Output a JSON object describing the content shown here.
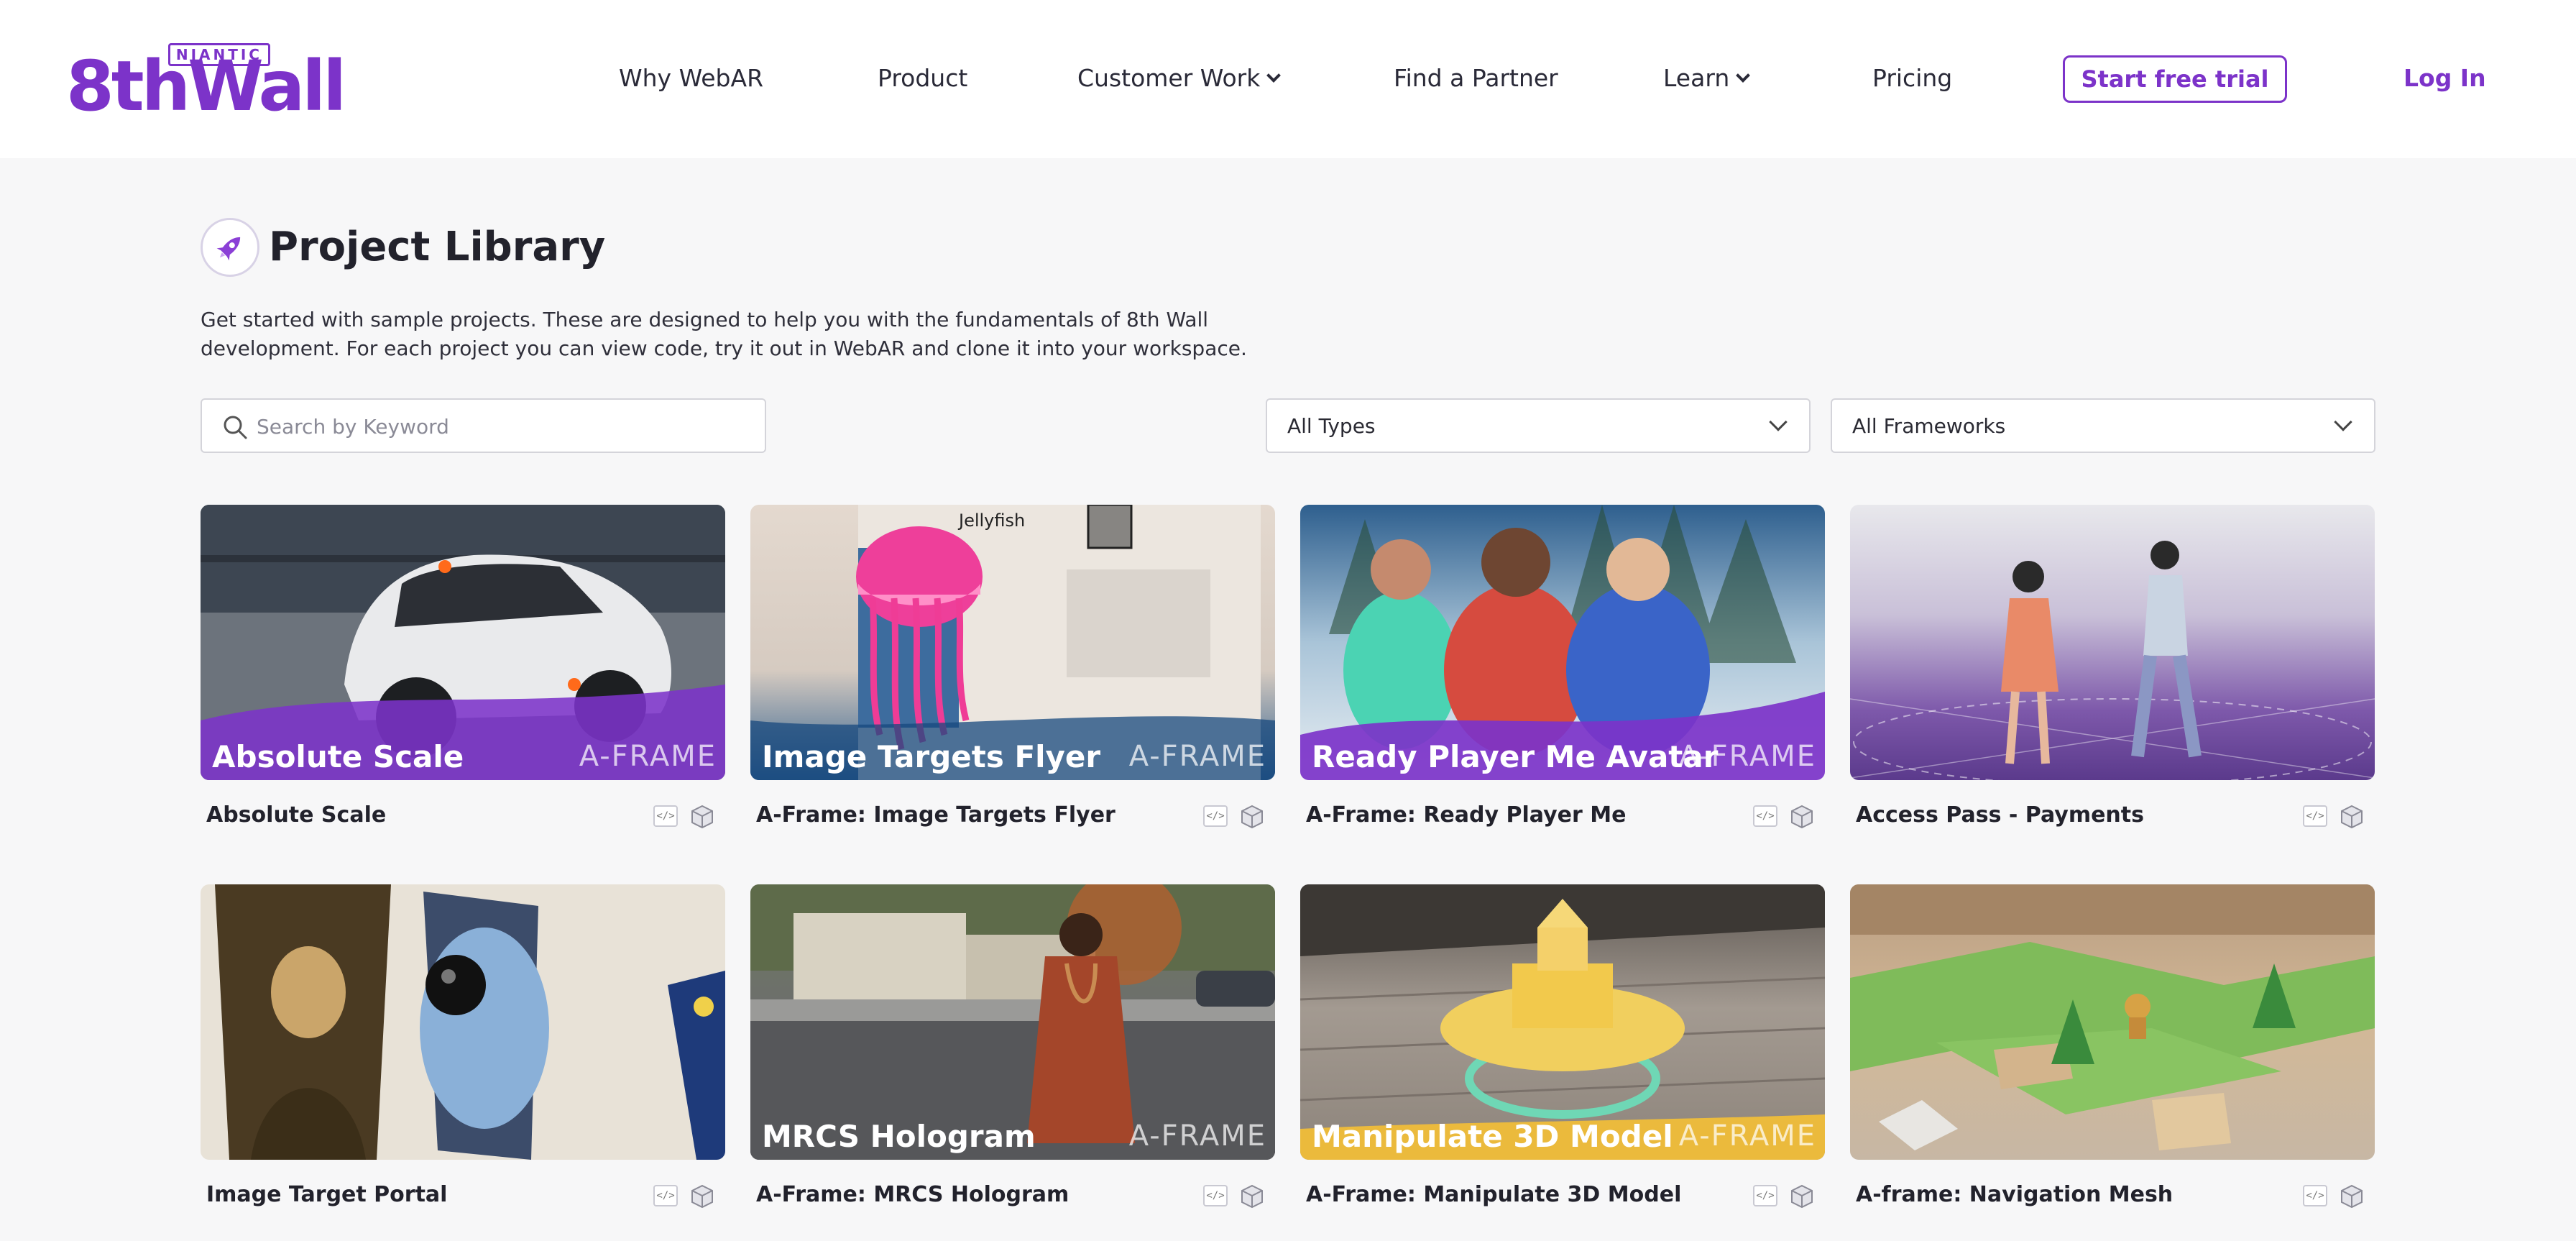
{
  "header": {
    "logo_badge": "NIANTIC",
    "logo_word": "8thWall",
    "nav": [
      {
        "label": "Why WebAR",
        "dropdown": false
      },
      {
        "label": "Product",
        "dropdown": false
      },
      {
        "label": "Customer Work",
        "dropdown": true
      },
      {
        "label": "Find a Partner",
        "dropdown": false
      },
      {
        "label": "Learn",
        "dropdown": true
      },
      {
        "label": "Pricing",
        "dropdown": false
      }
    ],
    "trial_button": "Start free trial",
    "login": "Log In"
  },
  "page": {
    "title": "Project Library",
    "intro": "Get started with sample projects. These are designed to help you with the fundamentals of 8th Wall development. For each project you can view code, try it out in WebAR and clone it into your workspace."
  },
  "filters": {
    "search_placeholder": "Search by Keyword",
    "search_value": "",
    "type_select": "All Types",
    "framework_select": "All Frameworks"
  },
  "projects": [
    {
      "title": "Absolute Scale",
      "thumb_label": "Absolute Scale",
      "thumb_tag": "A-FRAME"
    },
    {
      "title": "A-Frame: Image Targets Flyer",
      "thumb_label": "Image Targets Flyer",
      "thumb_tag": "A-FRAME",
      "thumb_heading": "Jellyfish"
    },
    {
      "title": "A-Frame: Ready Player Me",
      "thumb_label": "Ready Player Me Avatar",
      "thumb_tag": "A-FRAME"
    },
    {
      "title": "Access Pass - Payments",
      "thumb_label": "",
      "thumb_tag": ""
    },
    {
      "title": "Image Target Portal",
      "thumb_label": "",
      "thumb_tag": ""
    },
    {
      "title": "A-Frame: MRCS Hologram",
      "thumb_label": "MRCS Hologram",
      "thumb_tag": "A-FRAME"
    },
    {
      "title": "A-Frame: Manipulate 3D Model",
      "thumb_label": "Manipulate 3D Model",
      "thumb_tag": "A-FRAME"
    },
    {
      "title": "A-frame: Navigation Mesh",
      "thumb_label": "",
      "thumb_tag": ""
    }
  ],
  "icons": {
    "title_icon": "rocket-icon",
    "search": "search-icon",
    "card_code": "code-icon",
    "card_3d": "cube-icon"
  },
  "colors": {
    "brand": "#7c33c9",
    "background": "#f7f7f8"
  }
}
